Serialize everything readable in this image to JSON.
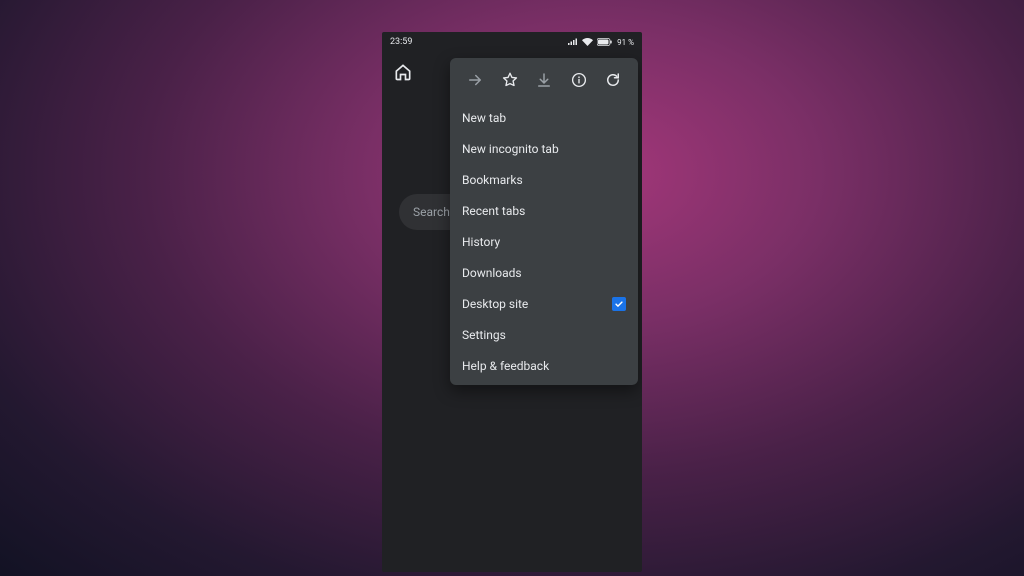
{
  "status": {
    "time": "23:59",
    "battery": "91 %"
  },
  "search": {
    "placeholder": "Search or"
  },
  "menu": {
    "items": [
      {
        "label": "New tab"
      },
      {
        "label": "New incognito tab"
      },
      {
        "label": "Bookmarks"
      },
      {
        "label": "Recent tabs"
      },
      {
        "label": "History"
      },
      {
        "label": "Downloads"
      },
      {
        "label": "Desktop site",
        "checked": true
      },
      {
        "label": "Settings"
      },
      {
        "label": "Help & feedback"
      }
    ]
  }
}
